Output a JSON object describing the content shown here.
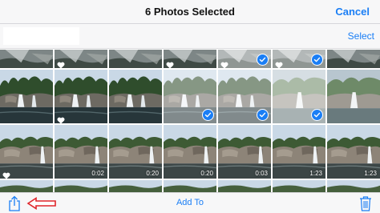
{
  "nav": {
    "title": "6 Photos Selected",
    "cancel_label": "Cancel"
  },
  "subbar": {
    "select_label": "Select"
  },
  "toolbar": {
    "add_label": "Add To",
    "share_icon": "share-icon",
    "trash_icon": "trash-icon",
    "arrow_annotation": "red-arrow-annotation"
  },
  "colors": {
    "accent": "#1a7ef5",
    "arrow": "#e0262b",
    "bar_bg": "#f7f7f8"
  },
  "photos": [
    {
      "scene": "top",
      "favorite": false,
      "selected": false
    },
    {
      "scene": "top",
      "favorite": true,
      "selected": false
    },
    {
      "scene": "top",
      "favorite": false,
      "selected": false
    },
    {
      "scene": "top",
      "favorite": true,
      "selected": false
    },
    {
      "scene": "top",
      "favorite": true,
      "selected": true
    },
    {
      "scene": "top",
      "favorite": true,
      "selected": true
    },
    {
      "scene": "top",
      "favorite": false,
      "selected": false
    },
    {
      "scene": "falls",
      "favorite": false,
      "selected": false
    },
    {
      "scene": "falls",
      "favorite": true,
      "selected": false
    },
    {
      "scene": "falls",
      "favorite": false,
      "selected": false
    },
    {
      "scene": "falls",
      "favorite": false,
      "selected": true
    },
    {
      "scene": "falls",
      "favorite": false,
      "selected": true
    },
    {
      "scene": "fallsFog",
      "favorite": false,
      "selected": true
    },
    {
      "scene": "fallsFog",
      "favorite": false,
      "selected": false
    },
    {
      "scene": "rocks",
      "favorite": true,
      "selected": false
    },
    {
      "scene": "rocks",
      "favorite": false,
      "selected": false,
      "duration": "0:02"
    },
    {
      "scene": "rocks",
      "favorite": false,
      "selected": false,
      "duration": "0:20"
    },
    {
      "scene": "rocks",
      "favorite": false,
      "selected": false,
      "duration": "0:20"
    },
    {
      "scene": "rocks",
      "favorite": false,
      "selected": false,
      "duration": "0:03"
    },
    {
      "scene": "rocks",
      "favorite": false,
      "selected": false,
      "duration": "1:23"
    },
    {
      "scene": "rocks",
      "favorite": false,
      "selected": false,
      "duration": "1:23"
    },
    {
      "scene": "strip",
      "favorite": false,
      "selected": false
    },
    {
      "scene": "strip",
      "favorite": false,
      "selected": false
    },
    {
      "scene": "strip",
      "favorite": false,
      "selected": false
    },
    {
      "scene": "strip",
      "favorite": false,
      "selected": false
    },
    {
      "scene": "strip",
      "favorite": false,
      "selected": false
    },
    {
      "scene": "strip",
      "favorite": false,
      "selected": false
    },
    {
      "scene": "strip",
      "favorite": false,
      "selected": false
    }
  ]
}
